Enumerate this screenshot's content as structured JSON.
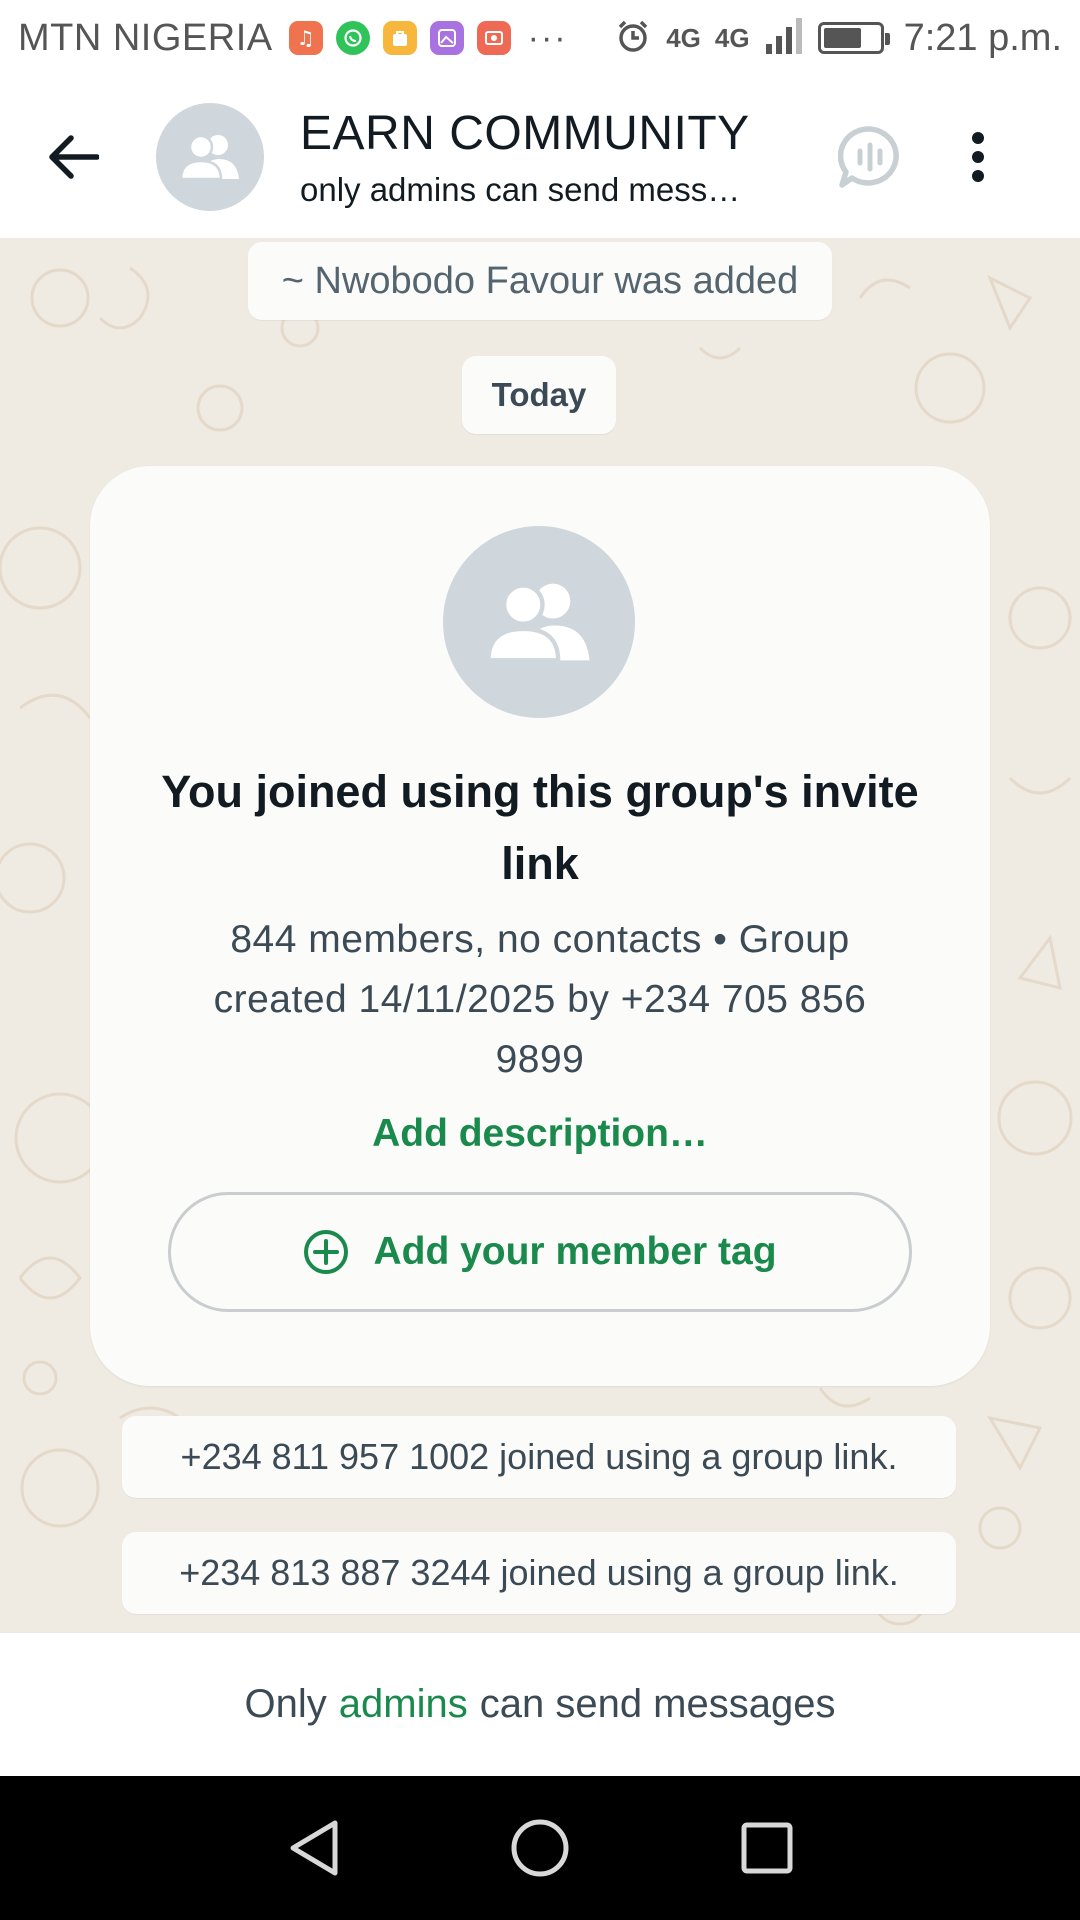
{
  "status_bar": {
    "carrier": "MTN NIGERIA",
    "notification_icons": [
      "music-app-icon",
      "whatsapp-icon",
      "bag-app-icon",
      "gallery-icon",
      "screen-recorder-icon"
    ],
    "more": "···",
    "network_1": "4G",
    "network_2": "4G",
    "battery_level": 0.7,
    "time": "7:21 p.m."
  },
  "header": {
    "title": "EARN COMMUNITY",
    "subtitle": "only admins can send mess…"
  },
  "chat": {
    "system_added": "~ Nwobodo Favour was added",
    "date_divider": "Today",
    "invite_card": {
      "title": "You joined using this group's invite link",
      "meta": "844 members, no contacts • Group created 14/11/2025 by +234 705 856 9899",
      "add_description": "Add description…",
      "member_tag_button": "Add your member tag"
    },
    "join_messages": [
      "+234 811 957 1002 joined using a group link.",
      "+234 813 887 3244 joined using a group link."
    ]
  },
  "footer": {
    "prefix": "Only",
    "link": "admins",
    "suffix": "can send messages"
  },
  "colors": {
    "accent_green": "#1a8a4c",
    "chat_background": "#efeae2",
    "avatar_gray": "#cfd6dc"
  }
}
